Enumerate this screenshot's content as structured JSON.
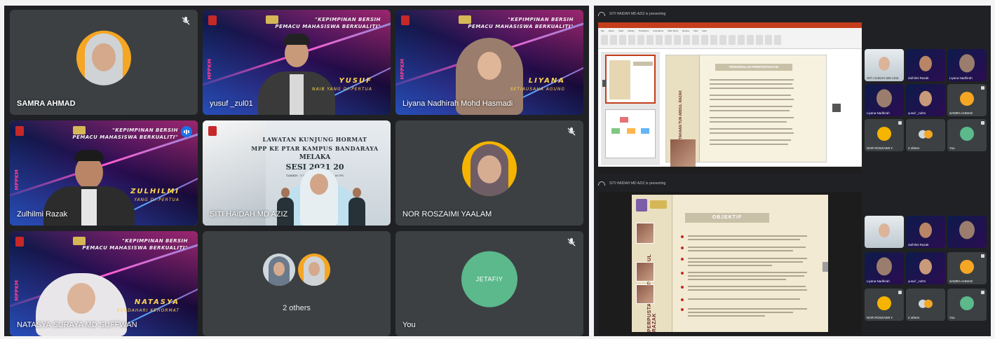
{
  "meeting": {
    "participants": [
      {
        "name": "SAMRA AHMAD"
      },
      {
        "name": "yusuf _zul01",
        "banner_name": "YUSUF",
        "banner_sub": "NAIB YANG DI-PERTUA"
      },
      {
        "name": "Liyana Nadhirah Mohd Hasmadi",
        "banner_name": "LIYANA",
        "banner_sub": "SETIAUSAHA AGUNG"
      },
      {
        "name": "Zulhilmi Razak",
        "banner_name": "ZULHILMI",
        "banner_sub": "YANG DI-PERTUA"
      },
      {
        "name": "SITI HAIDAH MD AZIZ"
      },
      {
        "name": "NOR ROSZAIMI YAALAM"
      },
      {
        "name": "NATASYA SURAYA MD SUFFWAN",
        "banner_name": "NATASYA",
        "banner_sub": "BENDAHARI KEHORMAT"
      },
      {
        "name": "2 others"
      },
      {
        "name": "You",
        "initial": "JETAFIY"
      }
    ],
    "banner": {
      "line1": "\"KEPIMPINAN BERSIH",
      "line2": "PEMACU MAHASISWA BERKUALITI\"",
      "tag": "MPPKM"
    },
    "event": {
      "line1": "LAWATAN KUNJUNG HORMAT",
      "line2": "MPP KE PTAR KAMPUS BANDARAYA",
      "line3": "MELAKA",
      "line4": "SESI 2021 20",
      "line5": "TARIKH : 1 MAC 2022  MASA : 10.00 PG"
    },
    "presenting": [
      {
        "label": "SITI HAIDAH MD AZIZ is presenting"
      },
      {
        "label": "SITI HAIDAH MD AZIZ is presenting"
      }
    ],
    "slide1": {
      "heading": "PENGENALAN PERPUSTAKAAN",
      "spine": "PERPUSTAKAAN TUN ABDUL RAZAK"
    },
    "slide2": {
      "heading": "OBJEKTIF",
      "spine": "PERPUSTAKAAN TUN ABDUL RAZAK"
    },
    "ppt_tabs": [
      "File",
      "Home",
      "Insert",
      "Design",
      "Transitions",
      "Animations",
      "Slide Show",
      "Review",
      "View",
      "Help"
    ],
    "grid_top": [
      {
        "name": "SITI HAIDAH MD AZIZ"
      },
      {
        "name": "Zulhilmi Razak"
      },
      {
        "name": "Liyana Nadhirah"
      },
      {
        "name": "Liyana Nadhirah"
      },
      {
        "name": "yusuf _zul01"
      },
      {
        "name": "SAMRA AHMAD"
      },
      {
        "name": "NOR ROSZAIMI Y."
      },
      {
        "name": "2 others"
      },
      {
        "name": "You"
      }
    ],
    "grid_bottom": [
      {
        "name": ""
      },
      {
        "name": "Zulhilmi Razak"
      },
      {
        "name": ""
      },
      {
        "name": "Liyana Nadhirah"
      },
      {
        "name": "yusuf _zul01"
      },
      {
        "name": "SAMRA AHMAD"
      },
      {
        "name": "NOR ROSZAIMI Y."
      },
      {
        "name": "2 others"
      },
      {
        "name": "You"
      }
    ],
    "colors": {
      "tile_bg": "#3c4043",
      "panel_bg": "#202124",
      "accent_speaking": "#1a73e8",
      "you_avatar": "#5bb98c",
      "avatar_ring": "#f5a623"
    },
    "icons": [
      "mic-off-icon",
      "speaking-indicator-icon",
      "presentation-icon"
    ]
  }
}
